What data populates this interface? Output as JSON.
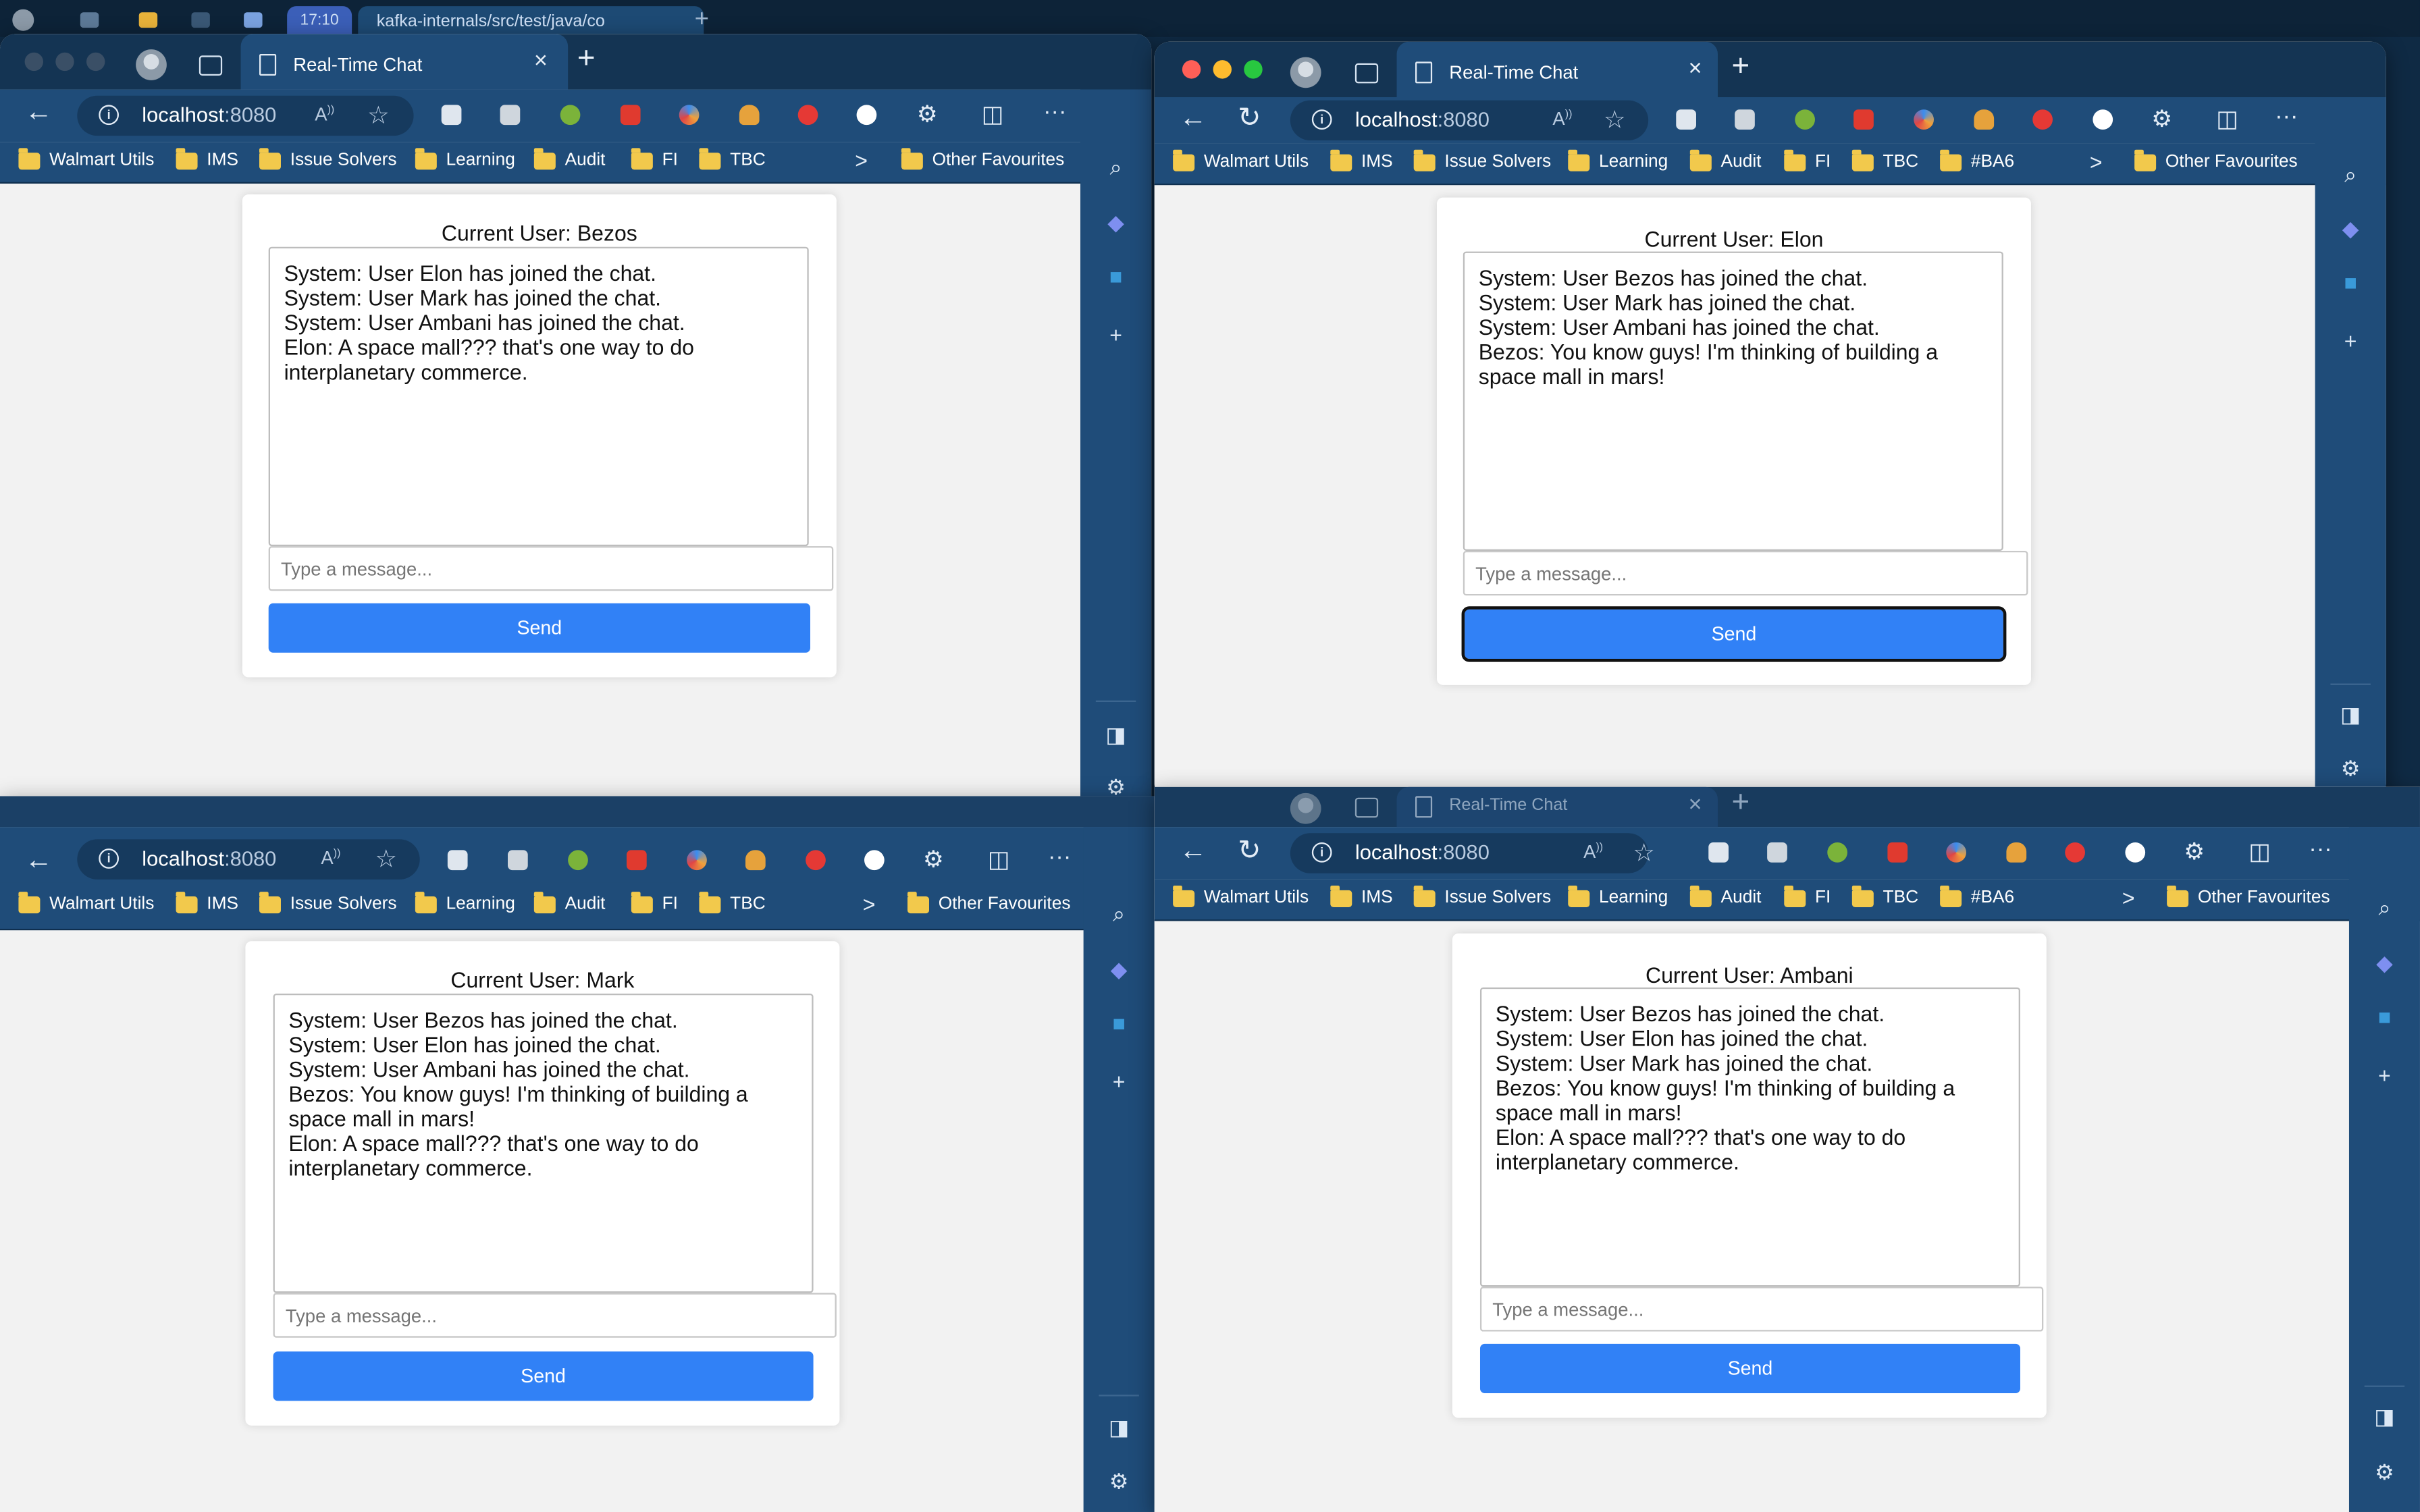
{
  "background_tab": {
    "title": "kafka-internals/src/test/java/co",
    "time_badge": "17:10"
  },
  "windows": [
    {
      "tab_title": "Real-Time Chat",
      "address": {
        "host": "localhost",
        "port": ":8080"
      },
      "bookmarks": [
        "Walmart Utils",
        "IMS",
        "Issue Solvers",
        "Learning",
        "Audit",
        "FI",
        "TBC"
      ],
      "other_favourites": "Other Favourites",
      "chat": {
        "current_user": "Current User: Bezos",
        "messages": [
          "System: User Elon has joined the chat.",
          "System: User Mark has joined the chat.",
          "System: User Ambani has joined the chat.",
          "Elon: A space mall??? that's one way to do interplanetary commerce."
        ],
        "input_placeholder": "Type a message...",
        "send_label": "Send"
      }
    },
    {
      "tab_title": "Real-Time Chat",
      "address": {
        "host": "localhost",
        "port": ":8080"
      },
      "bookmarks": [
        "Walmart Utils",
        "IMS",
        "Issue Solvers",
        "Learning",
        "Audit",
        "FI",
        "TBC",
        "#BA6"
      ],
      "other_favourites": "Other Favourites",
      "chat": {
        "current_user": "Current User: Elon",
        "messages": [
          "System: User Bezos has joined the chat.",
          "System: User Mark has joined the chat.",
          "System: User Ambani has joined the chat.",
          "Bezos: You know guys! I'm thinking of building a space mall in mars!"
        ],
        "input_placeholder": "Type a message...",
        "send_label": "Send"
      }
    },
    {
      "tab_title": "Real-Time Chat",
      "address": {
        "host": "localhost",
        "port": ":8080"
      },
      "bookmarks": [
        "Walmart Utils",
        "IMS",
        "Issue Solvers",
        "Learning",
        "Audit",
        "FI",
        "TBC"
      ],
      "other_favourites": "Other Favourites",
      "chat": {
        "current_user": "Current User: Mark",
        "messages": [
          "System: User Bezos has joined the chat.",
          "System: User Elon has joined the chat.",
          "System: User Ambani has joined the chat.",
          "Bezos: You know guys! I'm thinking of building a space mall in mars!",
          "Elon: A space mall??? that's one way to do interplanetary commerce."
        ],
        "input_placeholder": "Type a message...",
        "send_label": "Send"
      }
    },
    {
      "tab_title": "Real-Time Chat",
      "address": {
        "host": "localhost",
        "port": ":8080"
      },
      "bookmarks": [
        "Walmart Utils",
        "IMS",
        "Issue Solvers",
        "Learning",
        "Audit",
        "FI",
        "TBC",
        "#BA6"
      ],
      "other_favourites": "Other Favourites",
      "chat": {
        "current_user": "Current User: Ambani",
        "messages": [
          "System: User Bezos has joined the chat.",
          "System: User Elon has joined the chat.",
          "System: User Mark has joined the chat.",
          "Bezos: You know guys! I'm thinking of building a space mall in mars!",
          "Elon: A space mall??? that's one way to do interplanetary commerce."
        ],
        "input_placeholder": "Type a message...",
        "send_label": "Send"
      }
    }
  ]
}
